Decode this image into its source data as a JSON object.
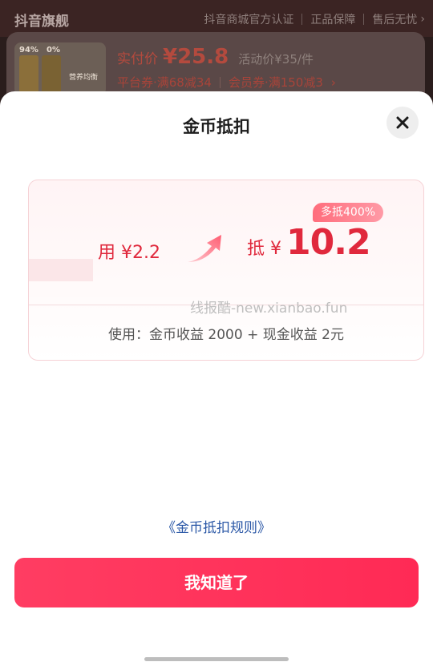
{
  "background": {
    "store_name": "抖音旗舰",
    "badges": [
      "抖音商城官方认证",
      "正品保障",
      "售后无忧"
    ],
    "product": {
      "thumb_labels": [
        "94%",
        "0%",
        "营养均衡"
      ],
      "actual_price_label": "实付价",
      "actual_price": "¥25.8",
      "activity_price": "活动价¥35/件",
      "coupons": [
        "平台券·满68减34",
        "会员券·满150减3"
      ]
    }
  },
  "modal": {
    "title": "金币抵扣",
    "close_icon": "close-icon",
    "card": {
      "use_amount": "用 ¥2.2",
      "offset_prefix": "抵 ¥",
      "offset_value": "10.2",
      "ratio_badge": "多抵400%",
      "usage_detail": "使用：金币收益 2000 + 现金收益 2元"
    },
    "watermark": "线报酷-new.xianbao.fun",
    "rules_link": "《金币抵扣规则》",
    "confirm_button": "我知道了"
  },
  "colors": {
    "accent": "#e0293d",
    "button": "#ff2a55",
    "link": "#2a57a6"
  }
}
